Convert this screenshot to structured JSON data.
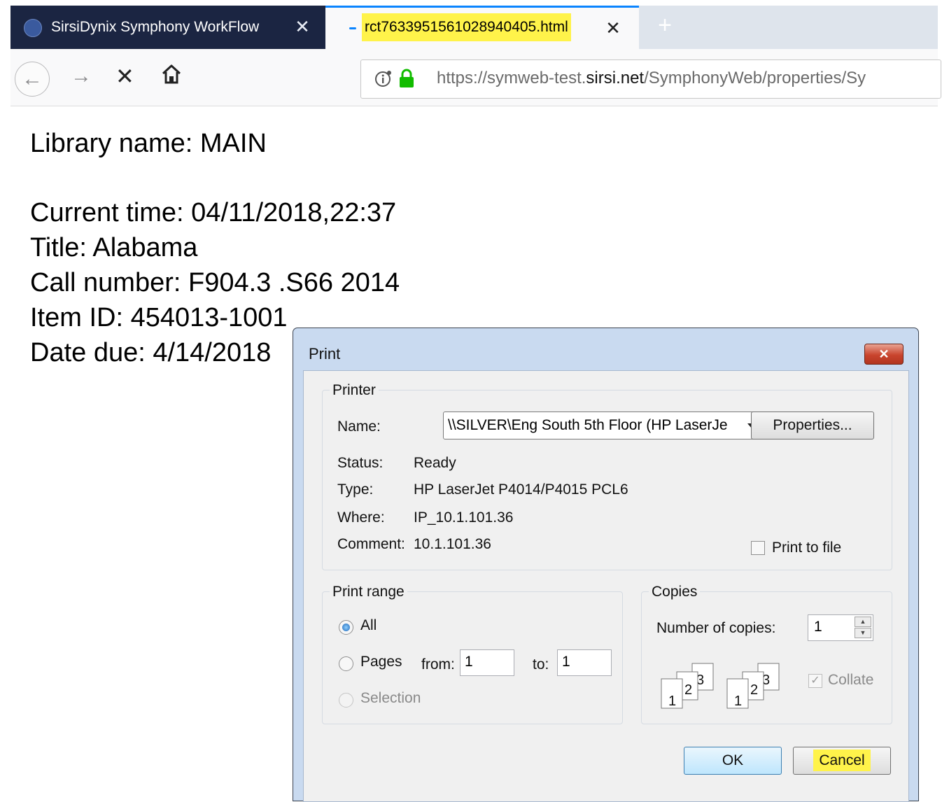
{
  "browser": {
    "tabs": [
      {
        "title": "SirsiDynix Symphony WorkFlow",
        "active": false,
        "close": "✕"
      },
      {
        "title": "rct7633951561028940405.html",
        "active": true,
        "close": "✕"
      }
    ],
    "new_tab": "+",
    "nav": {
      "back": "←",
      "forward": "→",
      "stop": "✕"
    },
    "url": {
      "prefix": "https://symweb-test.",
      "domain": "sirsi.net",
      "path": "/SymphonyWeb/properties/Sy"
    },
    "highlight_color": "#fff34a"
  },
  "page": {
    "library_name": "Library name: MAIN",
    "current_time": "Current time: 04/11/2018,22:37",
    "title": "Title: Alabama",
    "call_number": "Call number: F904.3 .S66 2014",
    "item_id": "Item ID: 454013-1001",
    "date_due": "Date due: 4/14/2018"
  },
  "print_dialog": {
    "title": "Print",
    "close": "✕",
    "printer": {
      "legend": "Printer",
      "name_label": "Name:",
      "name_value": "\\\\SILVER\\Eng South 5th Floor (HP LaserJe",
      "properties_button": "Properties...",
      "status_label": "Status:",
      "status_value": "Ready",
      "type_label": "Type:",
      "type_value": "HP LaserJet P4014/P4015 PCL6",
      "where_label": "Where:",
      "where_value": "IP_10.1.101.36",
      "comment_label": "Comment:",
      "comment_value": "10.1.101.36",
      "print_to_file": "Print to file",
      "print_to_file_checked": false
    },
    "print_range": {
      "legend": "Print range",
      "all": "All",
      "pages": "Pages",
      "from_label": "from:",
      "from_value": "1",
      "to_label": "to:",
      "to_value": "1",
      "selection": "Selection",
      "selected": "All"
    },
    "copies": {
      "legend": "Copies",
      "number_label": "Number of copies:",
      "number_value": "1",
      "collate": "Collate",
      "collate_checked": true,
      "collate_pages": [
        "1",
        "2",
        "3"
      ]
    },
    "ok_button": "OK",
    "cancel_button": "Cancel"
  }
}
